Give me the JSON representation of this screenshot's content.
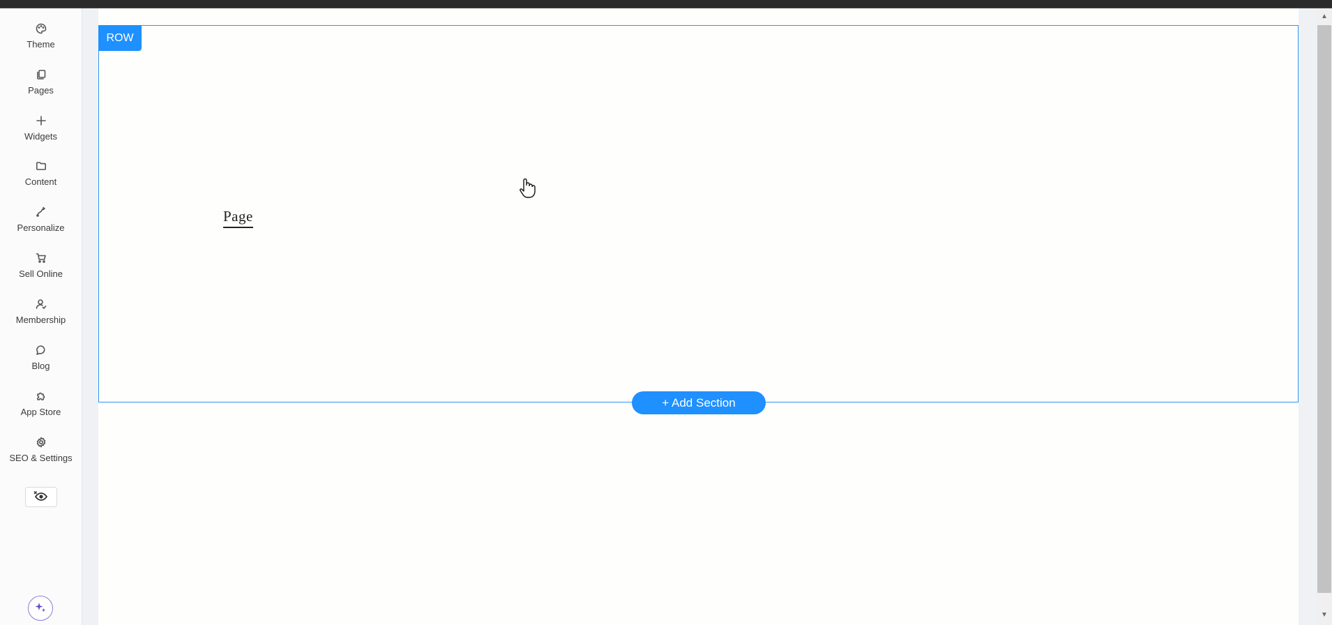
{
  "sidebar": {
    "items": [
      {
        "label": "Theme",
        "icon": "palette-icon"
      },
      {
        "label": "Pages",
        "icon": "pages-icon"
      },
      {
        "label": "Widgets",
        "icon": "plus-icon"
      },
      {
        "label": "Content",
        "icon": "folder-icon"
      },
      {
        "label": "Personalize",
        "icon": "personalize-icon"
      },
      {
        "label": "Sell Online",
        "icon": "cart-icon"
      },
      {
        "label": "Membership",
        "icon": "user-check-icon"
      },
      {
        "label": "Blog",
        "icon": "chat-bubble-icon"
      },
      {
        "label": "App Store",
        "icon": "puzzle-icon"
      },
      {
        "label": "SEO & Settings",
        "icon": "gear-icon"
      }
    ],
    "preview_icon": "eye-hide-icon",
    "ai_icon": "sparkle-icon"
  },
  "canvas": {
    "row_tag": "ROW",
    "page_link": "Page",
    "add_section_label": "+ Add Section"
  },
  "colors": {
    "accent": "#1e90ff",
    "selection_border": "#2f95f3",
    "ai_ring": "#8b7bd8"
  }
}
